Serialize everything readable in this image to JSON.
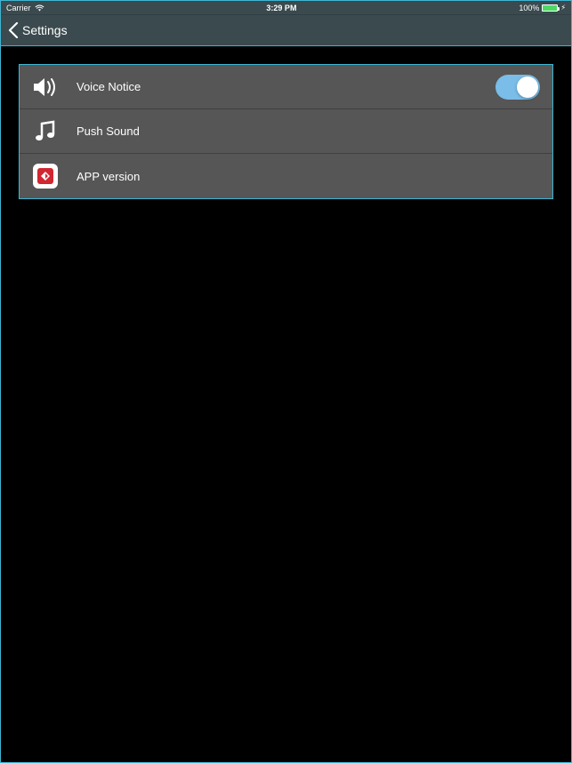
{
  "statusBar": {
    "carrier": "Carrier",
    "time": "3:29 PM",
    "batteryText": "100%"
  },
  "nav": {
    "title": "Settings"
  },
  "rows": {
    "voice": {
      "label": "Voice Notice",
      "toggleOn": true
    },
    "push": {
      "label": "Push Sound"
    },
    "app": {
      "label": "APP version"
    }
  }
}
